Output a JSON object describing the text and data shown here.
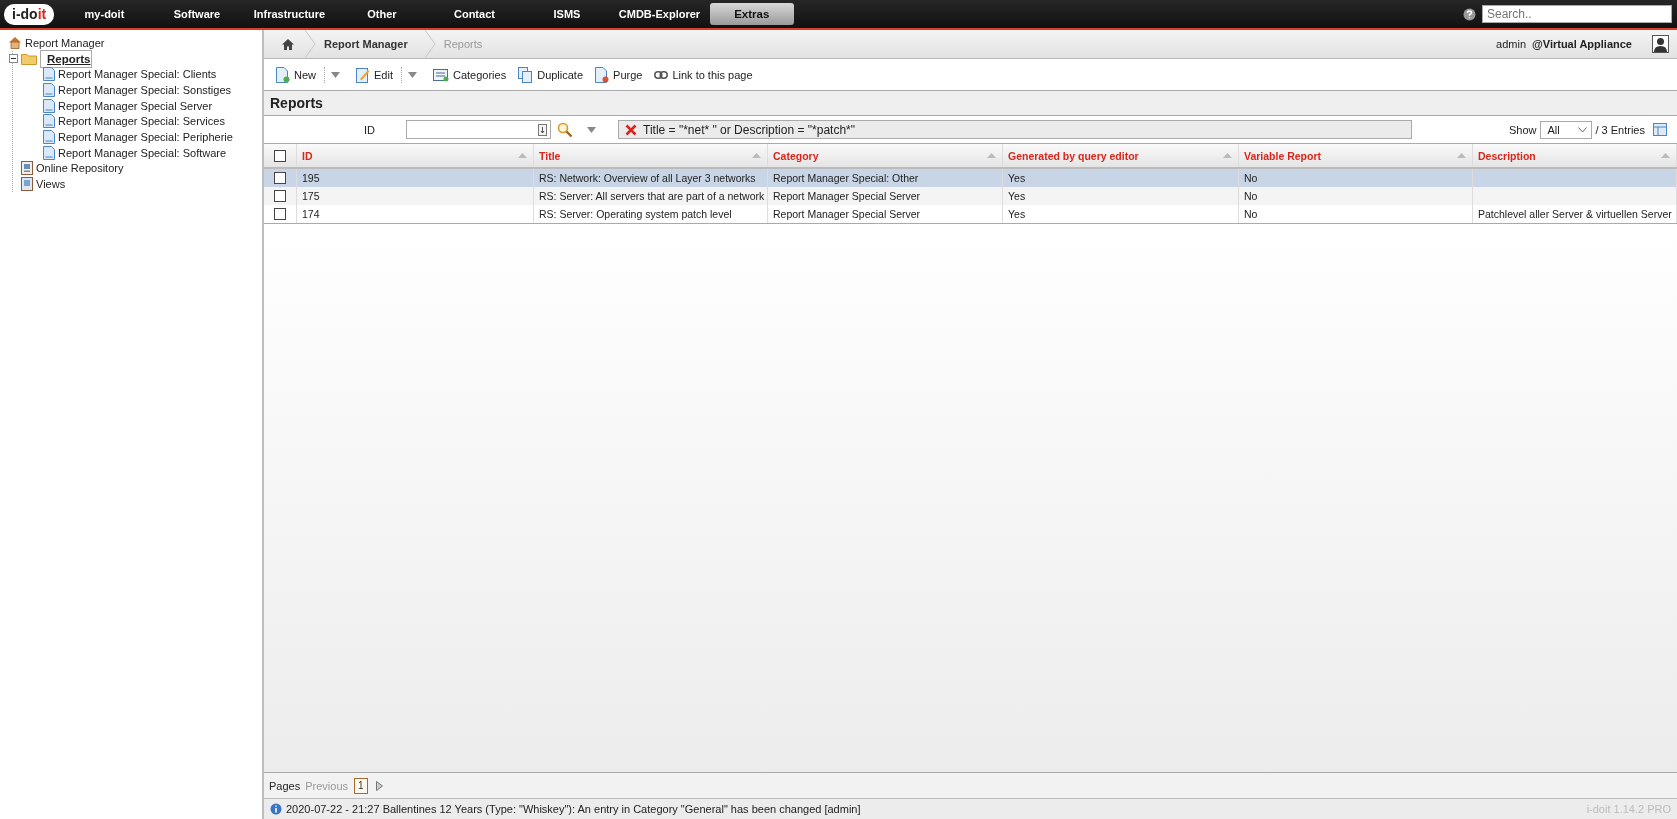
{
  "logo": {
    "text_main": "i-do",
    "text_accent": "it"
  },
  "nav": [
    {
      "label": "my-doit",
      "selected": false
    },
    {
      "label": "Software",
      "selected": false
    },
    {
      "label": "Infrastructure",
      "selected": false
    },
    {
      "label": "Other",
      "selected": false
    },
    {
      "label": "Contact",
      "selected": false
    },
    {
      "label": "ISMS",
      "selected": false
    },
    {
      "label": "CMDB-Explorer",
      "selected": false
    },
    {
      "label": "Extras",
      "selected": true
    }
  ],
  "search": {
    "placeholder": "Search.."
  },
  "sidebar": {
    "root": "Report Manager",
    "items": [
      {
        "label": "Reports",
        "kind": "folder",
        "expanded": true,
        "selected": true,
        "children": [
          {
            "label": "Report Manager Special: Clients",
            "kind": "report",
            "selected": false
          },
          {
            "label": "Report Manager Special: Sonstiges",
            "kind": "report",
            "selected": false
          },
          {
            "label": "Report Manager Special Server",
            "kind": "report",
            "selected": false
          },
          {
            "label": "Report Manager Special: Services",
            "kind": "report",
            "selected": false
          },
          {
            "label": "Report Manager Special: Peripherie",
            "kind": "report",
            "selected": false
          },
          {
            "label": "Report Manager Special: Software",
            "kind": "report",
            "selected": false
          }
        ]
      },
      {
        "label": "Online Repository",
        "kind": "repository",
        "selected": false
      },
      {
        "label": "Views",
        "kind": "views",
        "selected": false
      }
    ]
  },
  "breadcrumb": [
    "Report Manager",
    "Reports"
  ],
  "user": {
    "name": "admin",
    "tenant": "@Virtual Appliance"
  },
  "toolbar": [
    {
      "label": "New",
      "kind": "new",
      "dropdown": true
    },
    {
      "label": "Edit",
      "kind": "edit",
      "dropdown": true
    },
    {
      "label": "Categories",
      "kind": "categories",
      "dropdown": false
    },
    {
      "label": "Duplicate",
      "kind": "duplicate",
      "dropdown": false
    },
    {
      "label": "Purge",
      "kind": "purge",
      "dropdown": false
    },
    {
      "label": "Link to this page",
      "kind": "link",
      "dropdown": false
    }
  ],
  "page_title": "Reports",
  "filter": {
    "field_label": "ID",
    "query": "Title = \"*net* \" or Description = \"*patch*\"",
    "show_label": "Show",
    "show_value": "All",
    "entries": "/ 3 Entries"
  },
  "table": {
    "all_checked": false,
    "columns": [
      "ID",
      "Title",
      "Category",
      "Generated by query editor",
      "Variable Report",
      "Description"
    ],
    "rows": [
      {
        "selected": true,
        "checked": false,
        "cells": [
          "195",
          "RS: Network: Overview of all Layer 3 networks",
          "Report Manager Special: Other",
          "Yes",
          "No",
          ""
        ]
      },
      {
        "selected": false,
        "checked": false,
        "cells": [
          "175",
          "RS: Server: All servers that are part of a network",
          "Report Manager Special Server",
          "Yes",
          "No",
          ""
        ]
      },
      {
        "selected": false,
        "checked": false,
        "cells": [
          "174",
          "RS: Server: Operating system patch level",
          "Report Manager Special Server",
          "Yes",
          "No",
          "Patchlevel aller Server & virtuellen Server"
        ]
      }
    ]
  },
  "pager": {
    "label": "Pages",
    "previous": "Previous",
    "pages": [
      {
        "label": "1",
        "selected": true
      }
    ]
  },
  "status": {
    "message": "2020-07-22 - 21:27 Ballentines 12 Years (Type: \"Whiskey\"): An entry in Category \"General\" has been changed [admin]",
    "version": "i-doit 1.14.2 PRO"
  }
}
